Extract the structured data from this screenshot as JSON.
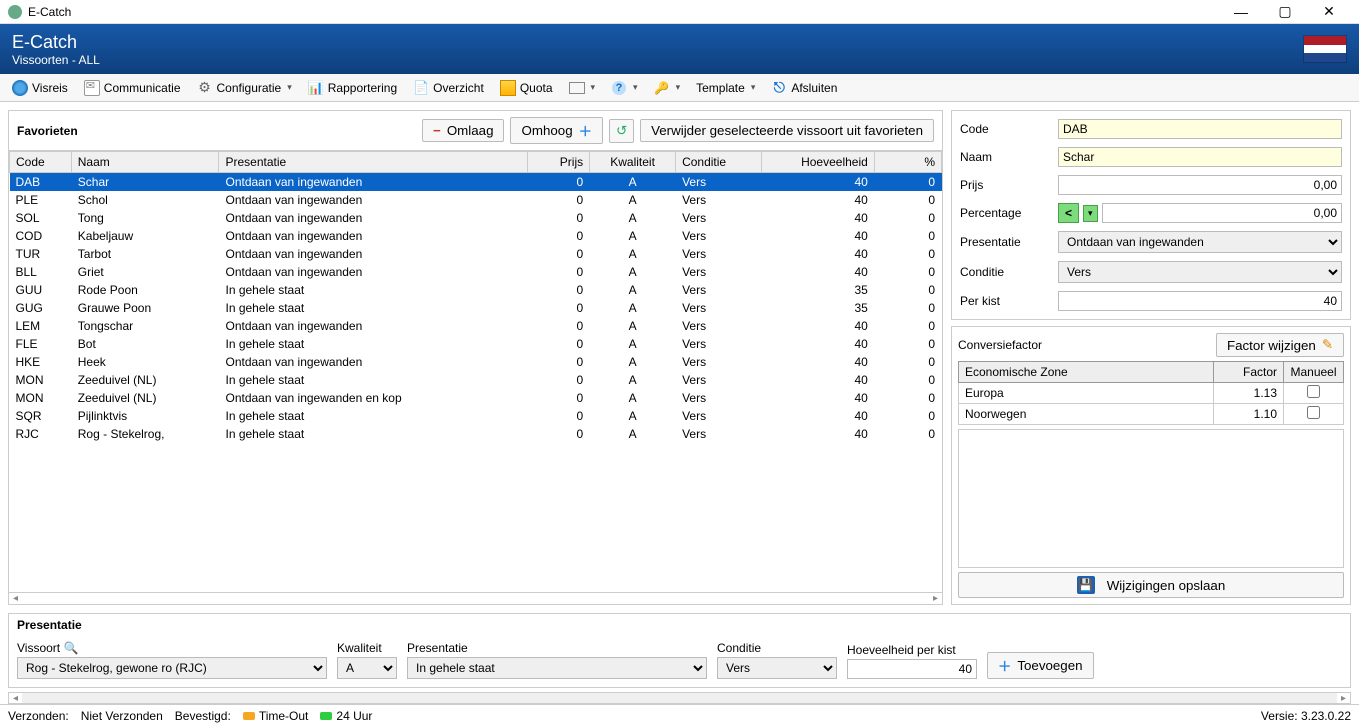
{
  "window": {
    "title": "E-Catch"
  },
  "header": {
    "title": "E-Catch",
    "subtitle": "Vissoorten - ALL"
  },
  "toolbar": {
    "visreis": "Visreis",
    "communicatie": "Communicatie",
    "configuratie": "Configuratie",
    "rapportering": "Rapportering",
    "overzicht": "Overzicht",
    "quota": "Quota",
    "template": "Template",
    "afsluiten": "Afsluiten"
  },
  "fav": {
    "title": "Favorieten",
    "omlaag": "Omlaag",
    "omhoog": "Omhoog",
    "remove": "Verwijder geselecteerde vissoort uit favorieten",
    "columns": {
      "code": "Code",
      "naam": "Naam",
      "presentatie": "Presentatie",
      "prijs": "Prijs",
      "kwaliteit": "Kwaliteit",
      "conditie": "Conditie",
      "hoeveelheid": "Hoeveelheid",
      "pct": "%"
    },
    "rows": [
      {
        "code": "DAB",
        "naam": "Schar",
        "pres": "Ontdaan van ingewanden",
        "prijs": "0",
        "kw": "A",
        "cond": "Vers",
        "hv": "40",
        "pct": "0"
      },
      {
        "code": "PLE",
        "naam": "Schol",
        "pres": "Ontdaan van ingewanden",
        "prijs": "0",
        "kw": "A",
        "cond": "Vers",
        "hv": "40",
        "pct": "0"
      },
      {
        "code": "SOL",
        "naam": "Tong",
        "pres": "Ontdaan van ingewanden",
        "prijs": "0",
        "kw": "A",
        "cond": "Vers",
        "hv": "40",
        "pct": "0"
      },
      {
        "code": "COD",
        "naam": "Kabeljauw",
        "pres": "Ontdaan van ingewanden",
        "prijs": "0",
        "kw": "A",
        "cond": "Vers",
        "hv": "40",
        "pct": "0"
      },
      {
        "code": "TUR",
        "naam": "Tarbot",
        "pres": "Ontdaan van ingewanden",
        "prijs": "0",
        "kw": "A",
        "cond": "Vers",
        "hv": "40",
        "pct": "0"
      },
      {
        "code": "BLL",
        "naam": "Griet",
        "pres": "Ontdaan van ingewanden",
        "prijs": "0",
        "kw": "A",
        "cond": "Vers",
        "hv": "40",
        "pct": "0"
      },
      {
        "code": "GUU",
        "naam": "Rode Poon",
        "pres": "In gehele staat",
        "prijs": "0",
        "kw": "A",
        "cond": "Vers",
        "hv": "35",
        "pct": "0"
      },
      {
        "code": "GUG",
        "naam": "Grauwe Poon",
        "pres": "In gehele staat",
        "prijs": "0",
        "kw": "A",
        "cond": "Vers",
        "hv": "35",
        "pct": "0"
      },
      {
        "code": "LEM",
        "naam": "Tongschar",
        "pres": "Ontdaan van ingewanden",
        "prijs": "0",
        "kw": "A",
        "cond": "Vers",
        "hv": "40",
        "pct": "0"
      },
      {
        "code": "FLE",
        "naam": "Bot",
        "pres": "In gehele staat",
        "prijs": "0",
        "kw": "A",
        "cond": "Vers",
        "hv": "40",
        "pct": "0"
      },
      {
        "code": "HKE",
        "naam": "Heek",
        "pres": "Ontdaan van ingewanden",
        "prijs": "0",
        "kw": "A",
        "cond": "Vers",
        "hv": "40",
        "pct": "0"
      },
      {
        "code": "MON",
        "naam": "Zeeduivel (NL)",
        "pres": "In gehele staat",
        "prijs": "0",
        "kw": "A",
        "cond": "Vers",
        "hv": "40",
        "pct": "0"
      },
      {
        "code": "MON",
        "naam": "Zeeduivel (NL)",
        "pres": "Ontdaan van ingewanden en kop",
        "prijs": "0",
        "kw": "A",
        "cond": "Vers",
        "hv": "40",
        "pct": "0"
      },
      {
        "code": "SQR",
        "naam": "Pijlinktvis",
        "pres": "In gehele staat",
        "prijs": "0",
        "kw": "A",
        "cond": "Vers",
        "hv": "40",
        "pct": "0"
      },
      {
        "code": "RJC",
        "naam": "Rog - Stekelrog,",
        "pres": "In gehele staat",
        "prijs": "0",
        "kw": "A",
        "cond": "Vers",
        "hv": "40",
        "pct": "0"
      }
    ]
  },
  "detail": {
    "labels": {
      "code": "Code",
      "naam": "Naam",
      "prijs": "Prijs",
      "pct": "Percentage",
      "pres": "Presentatie",
      "cond": "Conditie",
      "perkist": "Per kist"
    },
    "code": "DAB",
    "naam": "Schar",
    "prijs": "0,00",
    "pct": "0,00",
    "pct_op": "<",
    "pres": "Ontdaan van ingewanden",
    "cond": "Vers",
    "perkist": "40"
  },
  "conv": {
    "title": "Conversiefactor",
    "edit": "Factor wijzigen",
    "cols": {
      "zone": "Economische Zone",
      "factor": "Factor",
      "man": "Manueel"
    },
    "rows": [
      {
        "zone": "Europa",
        "factor": "1.13",
        "man": false
      },
      {
        "zone": "Noorwegen",
        "factor": "1.10",
        "man": false
      }
    ],
    "save": "Wijzigingen opslaan"
  },
  "pres": {
    "title": "Presentatie",
    "labels": {
      "vissoort": "Vissoort",
      "kwaliteit": "Kwaliteit",
      "presentatie": "Presentatie",
      "conditie": "Conditie",
      "hpk": "Hoeveelheid per kist"
    },
    "vissoort": "Rog - Stekelrog, gewone ro (RJC)",
    "kwaliteit": "A",
    "presentatie": "In gehele staat",
    "conditie": "Vers",
    "hpk": "40",
    "toevoegen": "Toevoegen"
  },
  "status": {
    "verzonden": "Verzonden:",
    "niet": "Niet Verzonden",
    "bevestigd": "Bevestigd:",
    "timeout": "Time-Out",
    "uur": "24 Uur",
    "versie": "Versie: 3.23.0.22"
  }
}
